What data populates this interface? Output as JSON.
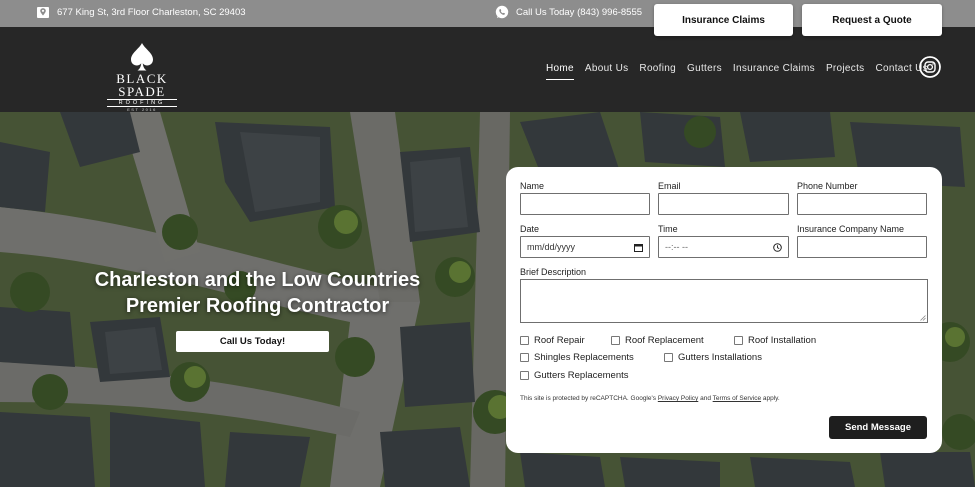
{
  "topbar": {
    "address": "677 King St, 3rd Floor Charleston, SC 29403",
    "address_icon": "map-icon",
    "phone": "Call Us Today (843) 996-8555",
    "phone_icon": "whatsapp-icon",
    "claims_label": "Insurance Claims",
    "quote_label": "Request a Quote"
  },
  "logo": {
    "brand": "BLACK SPADE",
    "sub": "ROOFING",
    "est": "EST 2016"
  },
  "nav": {
    "items": [
      {
        "label": "Home",
        "active": true
      },
      {
        "label": "About Us"
      },
      {
        "label": "Roofing"
      },
      {
        "label": "Gutters"
      },
      {
        "label": "Insurance Claims"
      },
      {
        "label": "Projects"
      },
      {
        "label": "Contact Us"
      }
    ],
    "social_icon": "instagram-icon"
  },
  "hero": {
    "headline_1": "Charleston and the Low Countries",
    "headline_2": "Premier Roofing Contractor",
    "cta_label": "Call Us Today!"
  },
  "form": {
    "name_label": "Name",
    "email_label": "Email",
    "phone_label": "Phone Number",
    "date_label": "Date",
    "date_placeholder": "mm/dd/yyyy",
    "time_label": "Time",
    "time_placeholder": "--:-- --",
    "insurance_label": "Insurance Company Name",
    "description_label": "Brief Description",
    "checkboxes": [
      "Roof Repair",
      "Roof Replacement",
      "Roof Installation",
      "Shingles Replacements",
      "Gutters Installations",
      "Gutters Replacements"
    ],
    "recaptcha_prefix": "This site is protected by reCAPTCHA. Google's",
    "privacy_link": "Privacy Policy",
    "and_text": "and",
    "terms_link": "Terms of Service",
    "apply_text": "apply.",
    "send_label": "Send Message"
  },
  "colors": {
    "topbar": "#8d8d8d",
    "header": "#272727",
    "button_dark": "#1e1e1e",
    "accent_white": "#ffffff"
  }
}
